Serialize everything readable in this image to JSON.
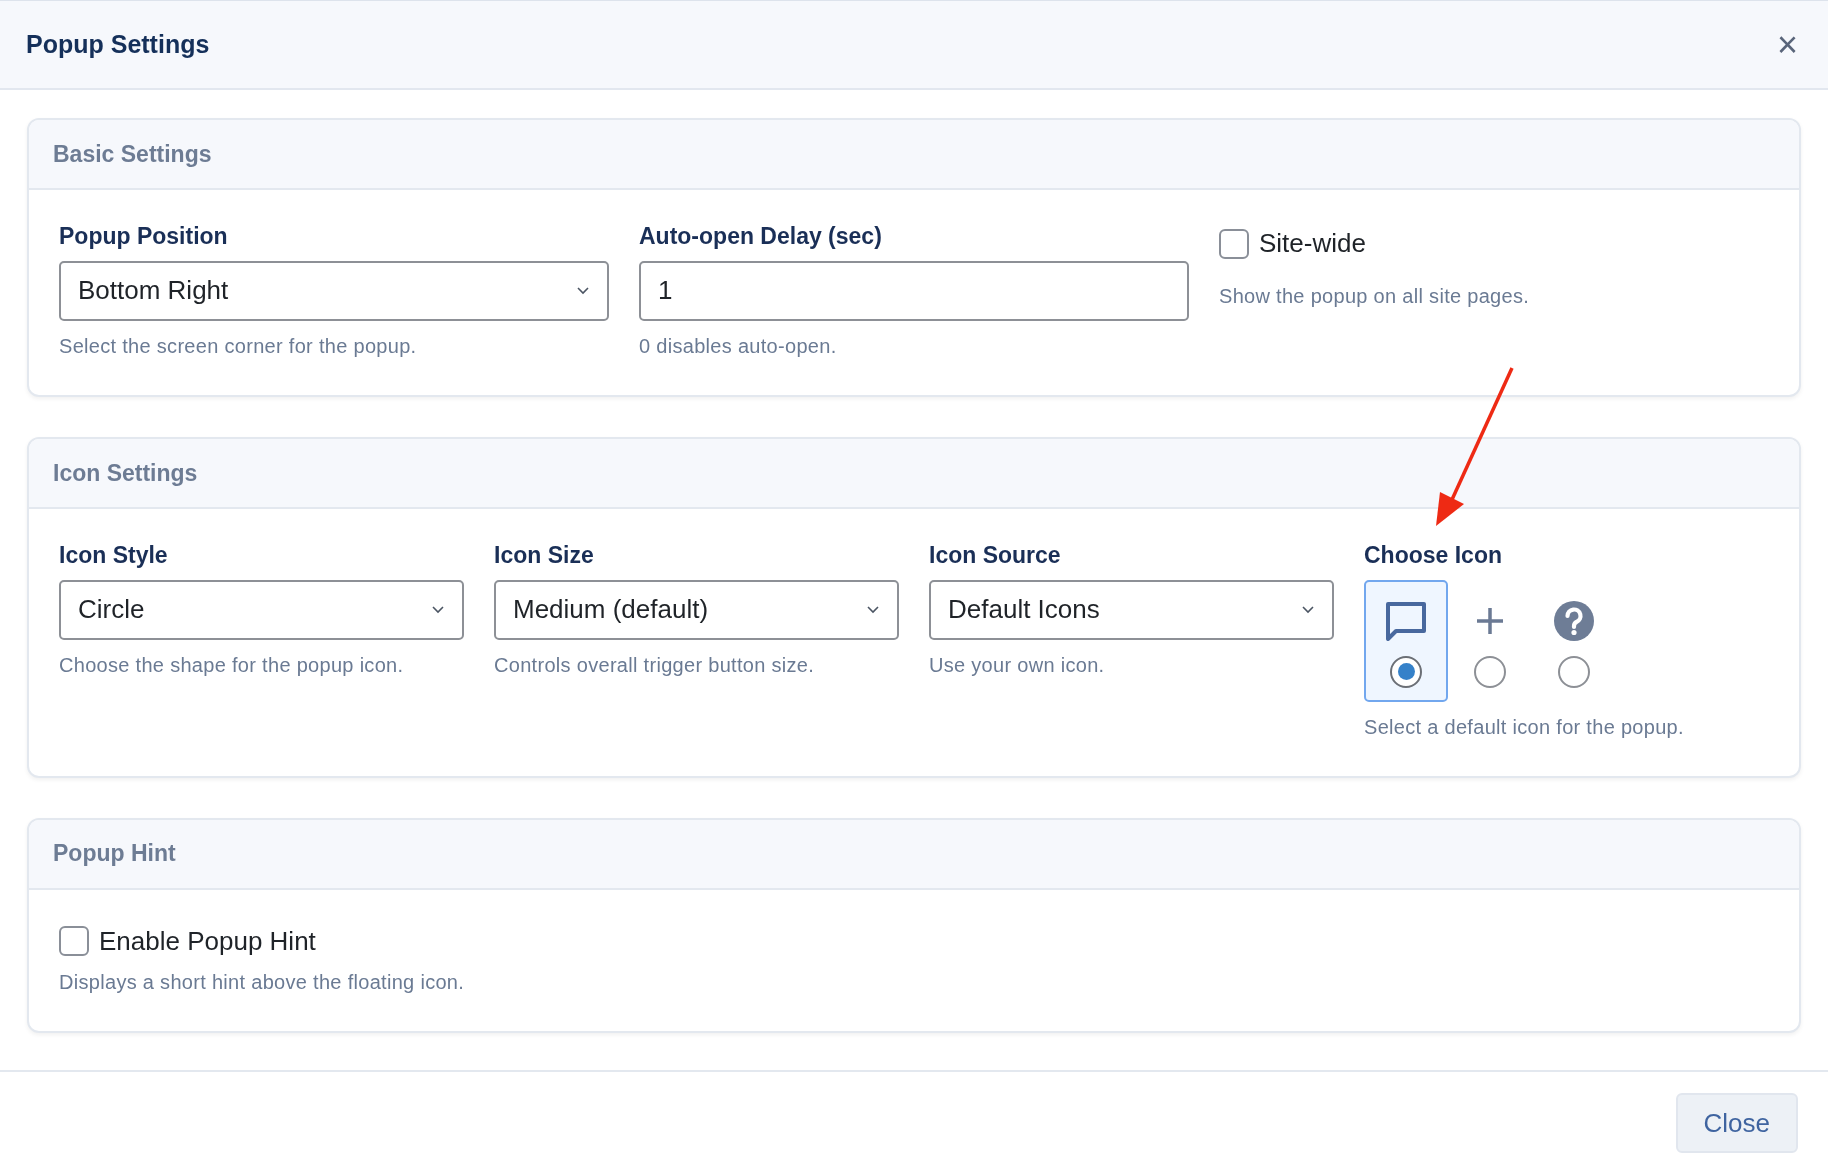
{
  "dialog": {
    "title": "Popup Settings",
    "close_symbol": "×"
  },
  "sections": [
    {
      "title": "Basic Settings",
      "fields": [
        {
          "kind": "select",
          "label": "Popup Position",
          "value": "Bottom Right",
          "help": "Select the screen corner for the popup."
        },
        {
          "kind": "input",
          "label": "Auto-open Delay (sec)",
          "value": "1",
          "help": "0 disables auto-open."
        },
        {
          "kind": "checkbox",
          "label": "Site-wide",
          "checked": false,
          "help": "Show the popup on all site pages."
        }
      ]
    },
    {
      "title": "Icon Settings",
      "fields": [
        {
          "kind": "select",
          "label": "Icon Style",
          "value": "Circle",
          "help": "Choose the shape for the popup icon."
        },
        {
          "kind": "select",
          "label": "Icon Size",
          "value": "Medium (default)",
          "help": "Controls overall trigger button size."
        },
        {
          "kind": "select",
          "label": "Icon Source",
          "value": "Default Icons",
          "help": "Use your own icon."
        },
        {
          "kind": "icon_choice",
          "label": "Choose Icon",
          "help": "Select a default icon for the popup.",
          "options": [
            {
              "kind": "chat",
              "selected": true
            },
            {
              "kind": "plus",
              "selected": false
            },
            {
              "kind": "question",
              "selected": false
            }
          ]
        }
      ]
    },
    {
      "title": "Popup Hint",
      "fields": [
        {
          "kind": "checkbox_wide",
          "label": "Enable Popup Hint",
          "checked": false,
          "help": "Displays a short hint above the floating icon."
        }
      ]
    }
  ],
  "footer": {
    "button": "Close"
  }
}
